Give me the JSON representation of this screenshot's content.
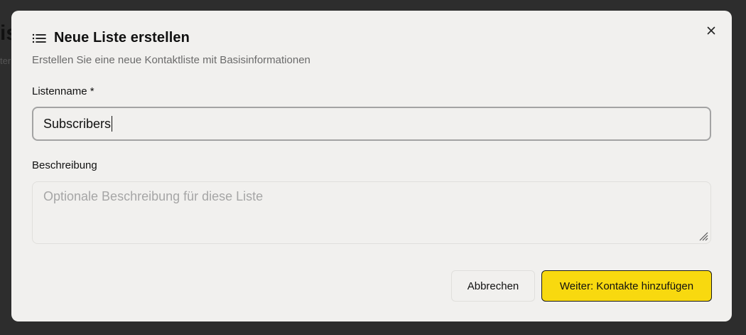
{
  "backdrop": {
    "heading_fragment": "is",
    "sub_fragment": "ter"
  },
  "dialog": {
    "title": "Neue Liste erstellen",
    "subtitle": "Erstellen Sie eine neue Kontaktliste mit Basisinformationen",
    "icons": {
      "title_icon": "list-icon",
      "close_icon": "close-icon"
    }
  },
  "form": {
    "name_label": "Listenname *",
    "name_value": "Subscribers",
    "description_label": "Beschreibung",
    "description_value": "",
    "description_placeholder": "Optionale Beschreibung für diese Liste"
  },
  "actions": {
    "cancel_label": "Abbrechen",
    "next_label": "Weiter: Kontakte hinzufügen"
  },
  "colors": {
    "backdrop": "#2d2d2d",
    "dialog_bg": "#f1f0ee",
    "primary_button": "#f8d90f",
    "muted_text": "#6b6b6b",
    "placeholder_text": "#a6a6a6"
  }
}
